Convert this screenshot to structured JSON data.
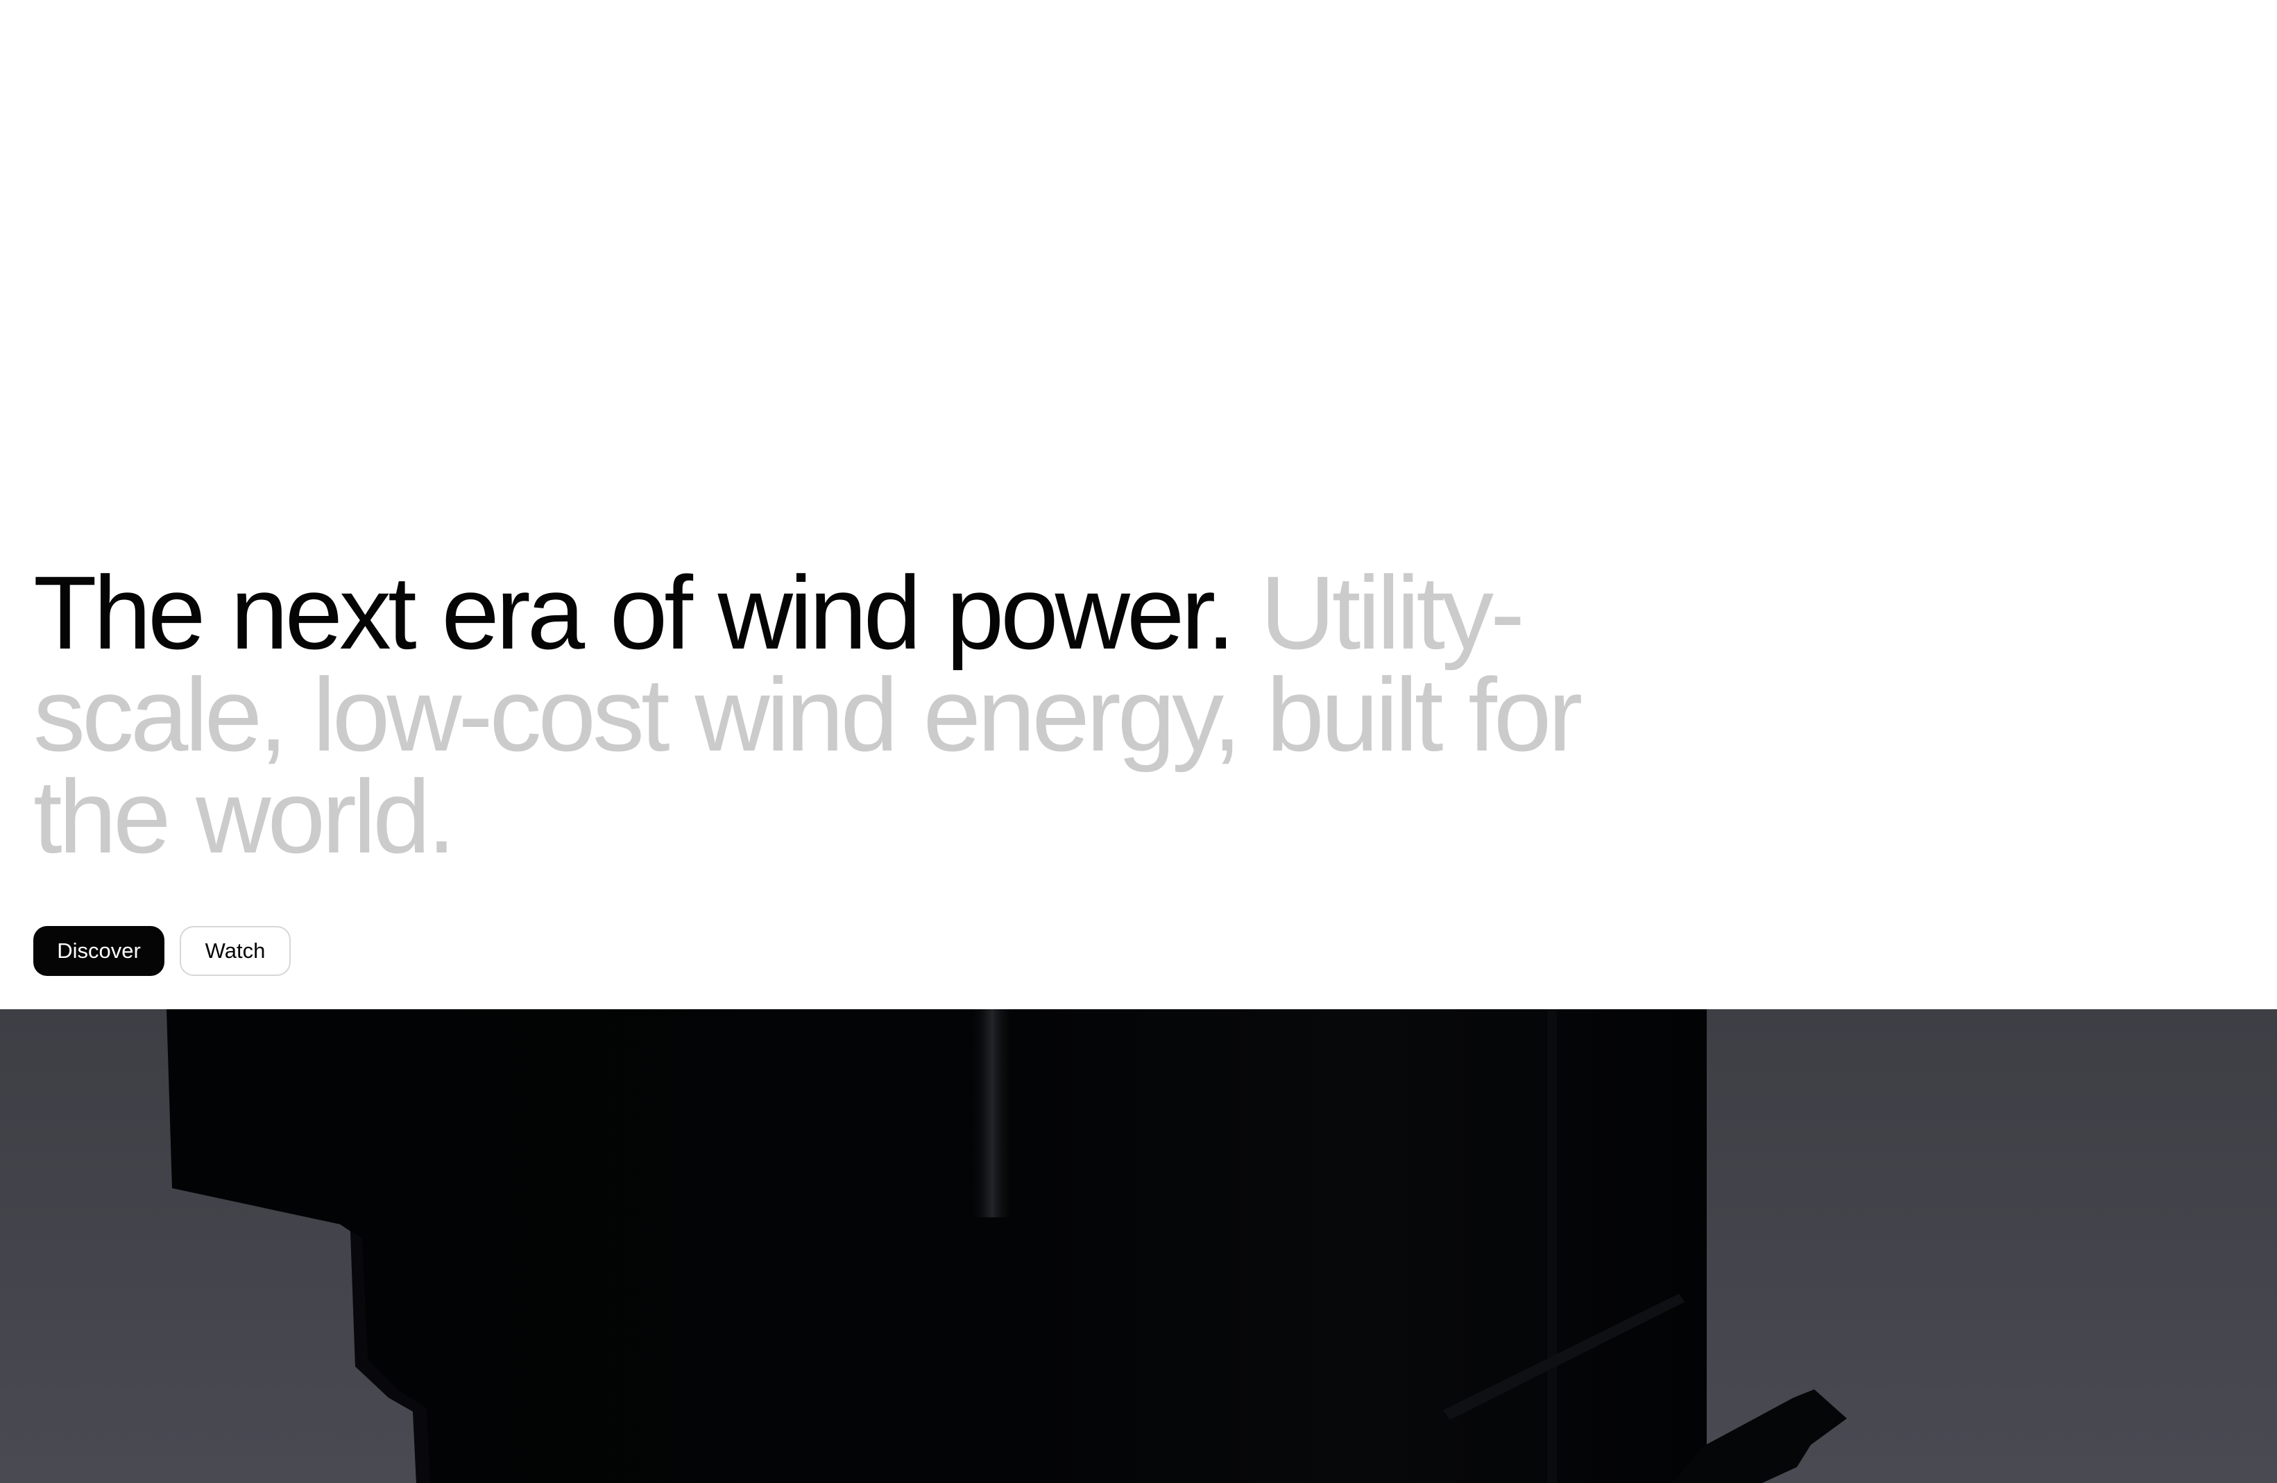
{
  "hero": {
    "headline_strong": "The next era of wind power.",
    "headline_muted": "Utility-scale, low-cost wind energy, built for the world."
  },
  "actions": {
    "discover_label": "Discover",
    "watch_label": "Watch"
  },
  "colors": {
    "text_primary": "#050505",
    "text_muted": "#cbcbcb",
    "button_primary_bg": "#050505",
    "button_secondary_border": "#d7d7d7",
    "media_sky": "#44444c",
    "media_structure": "#030405"
  }
}
